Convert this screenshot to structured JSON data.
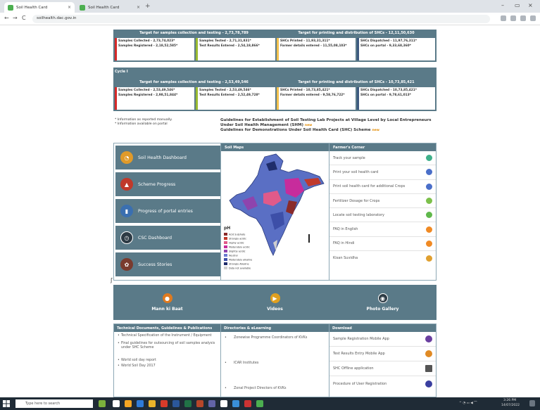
{
  "browser": {
    "tabs": [
      {
        "title": "Soil Health Card"
      },
      {
        "title": "Soil Health Card"
      }
    ],
    "new_tab": "+",
    "window": {
      "minimize": "–",
      "restore": "▭",
      "close": "×"
    },
    "nav": {
      "back": "←",
      "forward": "→",
      "reload": "C"
    },
    "url": "soilhealth.dac.gov.in"
  },
  "summary_top": {
    "left_header": "Target for samples collection and testing - 2,73,78,789",
    "right_header": "Target for printing and distribution of SHCs - 12,11,50,630",
    "cells": [
      "Samples Collected - 2,73,74,023*",
      "Samples Registered - 2,18,52,585*",
      "Samples Tested - 2,71,31,831*",
      "Test Results Entered - 2,54,18,866*",
      "SHCs Printed - 11,93,31,311*",
      "Farmer details entered - 11,55,08,103*",
      "SHCs Dispatched - 11,97,76,311*",
      "SHCs on portal - 9,33,68,360*"
    ],
    "colors": [
      "#d62828",
      "#f2c14e",
      "#3d5a80",
      "#9bbb30"
    ]
  },
  "cycle": {
    "label": "Cycle I",
    "left_header": "Target for samples collection and testing - 2,53,49,546",
    "right_header": "Target for printing and distribution of SHCs - 10,73,85,421",
    "cells": [
      "Samples Collected - 2,53,49,546*",
      "Samples Registered - 2,98,51,844*",
      "Samples Tested - 2,53,49,546*",
      "Test Results Entered - 2,52,49,728*",
      "SHCs Printed - 10,73,85,421*",
      "Farmer details entered - 9,58,76,722*",
      "SHCs Dispatched - 10,73,85,421*",
      "SHCs on portal - 9,78,61,013*"
    ]
  },
  "notes": [
    "* Information as reported manually.",
    "* Information available on portal"
  ],
  "guidelines": [
    "Guidelines for Establishment of Soil Testing Lab Projects at Village Level by Local Entrepreneurs Under Soil Health Management (SHM)",
    "Guidelines for Demonstrations Under Soil Health Card (SHC) Scheme"
  ],
  "new_tag": "new",
  "left_menu": [
    {
      "label": "Soil Health Dashboard",
      "icon": "gauge-icon",
      "color": "#e09a2a"
    },
    {
      "label": "Scheme Progress",
      "icon": "progress-icon",
      "color": "#c0392b"
    },
    {
      "label": "Progress of portal entries",
      "icon": "bar-chart-icon",
      "color": "#3a6fb0"
    },
    {
      "label": "CSC Dashboard",
      "icon": "dashboard-icon",
      "color": "#2d3b45"
    },
    {
      "label": "Success Stories",
      "icon": "stories-icon",
      "color": "#7a3b2e"
    }
  ],
  "soil_maps": {
    "title": "Soil Maps",
    "ph_label": "pH",
    "legend": [
      {
        "label": "Acid Sulphate",
        "color": "#8a2b2b"
      },
      {
        "label": "Strongly acidic",
        "color": "#c0392b"
      },
      {
        "label": "Highly acidic",
        "color": "#e05a8a"
      },
      {
        "label": "Moderately acidic",
        "color": "#c72c9c"
      },
      {
        "label": "Slightly acidic",
        "color": "#8e44ad"
      },
      {
        "label": "Neutral",
        "color": "#6c7bd1"
      },
      {
        "label": "Moderately alkaline",
        "color": "#3d4fa8"
      },
      {
        "label": "Strongly Alkaline",
        "color": "#1f2d6b"
      },
      {
        "label": "Data not available",
        "color": "#cfcfcf"
      }
    ]
  },
  "farmer_corner": {
    "title": "Farmer's Corner",
    "items": [
      {
        "label": "Track your sample",
        "icon": "flask-icon",
        "color": "#3fb08a"
      },
      {
        "label": "Print your soil health card",
        "icon": "printer-icon",
        "color": "#4a6fc9"
      },
      {
        "label": "Print soil health card for additional Crops",
        "icon": "printer-icon",
        "color": "#4a6fc9"
      },
      {
        "label": "Fertilizer Dosage for Crops",
        "icon": "leaf-icon",
        "color": "#7cc04b"
      },
      {
        "label": "Locate soil testing laboratory",
        "icon": "location-icon",
        "color": "#5fb84b"
      },
      {
        "label": "FAQ in English",
        "icon": "chat-icon",
        "color": "#f08a24"
      },
      {
        "label": "FAQ in Hindi",
        "icon": "chat-icon",
        "color": "#f08a24"
      },
      {
        "label": "Kisan Suvidha",
        "icon": "farmer-icon",
        "color": "#e0a030"
      }
    ]
  },
  "big_links": [
    {
      "label": "Mann ki Baat",
      "icon": "radio-icon",
      "color": "#e07a1f"
    },
    {
      "label": "Videos",
      "icon": "video-icon",
      "color": "#e0a020"
    },
    {
      "label": "Photo Gallery",
      "icon": "camera-icon",
      "color": "#2d3b45"
    }
  ],
  "tech_docs": {
    "title": "Technical Documents, Guidelines & Publications",
    "items": [
      "Technical Specification of the Instrument / Equipment",
      "Final guidelines for outsourcing of soil samples analysis under SHC Scheme",
      "World soil day report",
      "World Soil Day 2017"
    ]
  },
  "directories": {
    "title": "Directories & eLearning",
    "items": [
      "Zonewise Programme Coordinators of KVKs",
      "ICAR Institutes",
      "Zonal Project Directors of KVKs"
    ]
  },
  "download": {
    "title": "Download",
    "items": [
      {
        "label": "Sample Registration Mobile App",
        "icon": "mobile-icon",
        "color": "#6a3fa0"
      },
      {
        "label": "Test Results Entry Mobile App",
        "icon": "mobile-icon",
        "color": "#e08a24"
      },
      {
        "label": "SHC Offline application",
        "icon": "desktop-icon",
        "color": "#555555"
      },
      {
        "label": "Procedure of User Registration",
        "icon": "user-icon",
        "color": "#3a3fa0"
      }
    ]
  },
  "taskbar": {
    "search_placeholder": "Type here to search",
    "time": "3:26 PM",
    "date": "14/07/2022"
  }
}
